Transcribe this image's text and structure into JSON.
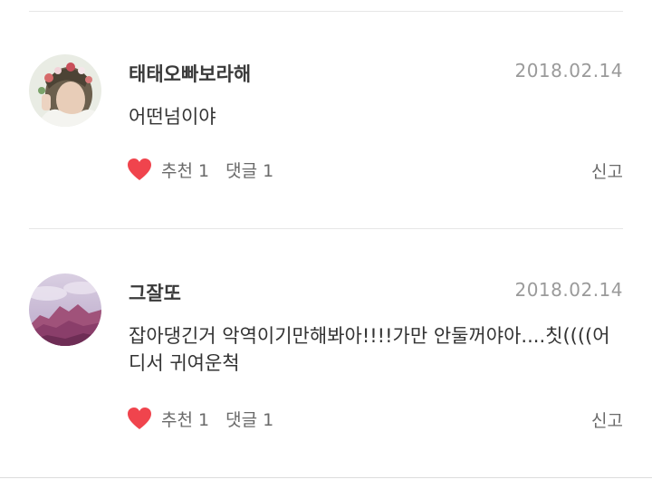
{
  "comments": [
    {
      "author": "태태오빠보라해",
      "date": "2018.02.14",
      "text": "어떤넘이야",
      "like_label": "추천 1",
      "reply_label": "댓글 1",
      "report_label": "신고",
      "avatar": "avatar-photo-flower-crown"
    },
    {
      "author": "그잘또",
      "date": "2018.02.14",
      "text": "잡아댕긴거 악역이기만해봐아!!!!가만 안둘꺼야아....칫((((어디서 귀여운척",
      "like_label": "추천 1",
      "reply_label": "댓글 1",
      "report_label": "신고",
      "avatar": "avatar-purple-mountain"
    }
  ],
  "colors": {
    "heart": "#f0444d",
    "divider": "#e6e6e6",
    "date": "#9a9a9a",
    "author": "#3a3a3a"
  }
}
